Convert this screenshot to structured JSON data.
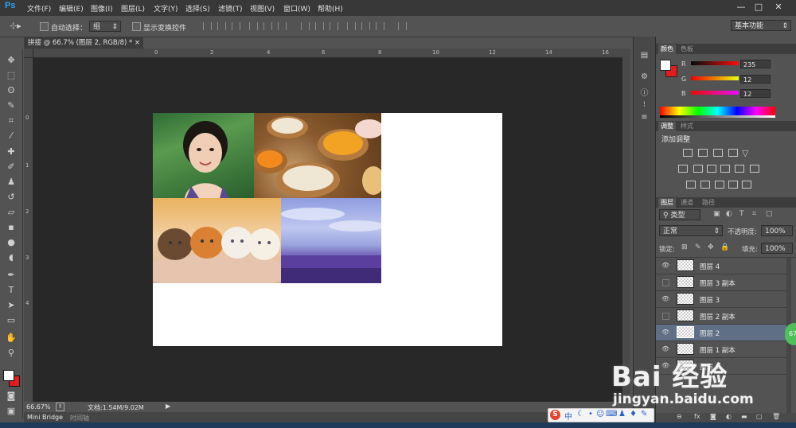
{
  "app": {
    "logo": "Ps"
  },
  "menu": [
    "文件(F)",
    "编辑(E)",
    "图像(I)",
    "图层(L)",
    "文字(Y)",
    "选择(S)",
    "滤镜(T)",
    "视图(V)",
    "窗口(W)",
    "帮助(H)"
  ],
  "window_controls": {
    "minimize": "—",
    "restore": "□",
    "close": "✕"
  },
  "options": {
    "auto_select_label": "自动选择：",
    "auto_select_value": "组",
    "show_transform_label": "显示变换控件",
    "workspace": "基本功能"
  },
  "document": {
    "tab_title": "拼接 @ 66.7% (图层 2, RGB/8) *",
    "close": "×"
  },
  "ruler_top": [
    "0",
    "2",
    "4",
    "6",
    "8",
    "10",
    "12",
    "14",
    "16"
  ],
  "ruler_left": [
    "0",
    "1",
    "2",
    "3",
    "4"
  ],
  "status": {
    "zoom": "66.67%",
    "doc_info": "文档:1.54M/9.02M"
  },
  "bottom_tabs": [
    "Mini Bridge",
    "时间轴"
  ],
  "color_panel": {
    "tabs": [
      "颜色",
      "色板"
    ],
    "r_label": "R",
    "g_label": "G",
    "b_label": "B",
    "r": "235",
    "g": "12",
    "b": "12",
    "foreground": "#eb0c0c"
  },
  "adjust_panel": {
    "tabs": [
      "调整",
      "样式"
    ],
    "title": "添加调整"
  },
  "layers_panel": {
    "tabs": [
      "图层",
      "通道",
      "路径"
    ],
    "filter_type": "类型",
    "blend_mode": "正常",
    "opacity_label": "不透明度:",
    "opacity": "100%",
    "lock_label": "锁定:",
    "fill_label": "填充:",
    "fill": "100%",
    "layers": [
      {
        "name": "图层 4",
        "visible": true,
        "selected": false
      },
      {
        "name": "图层 3 副本",
        "visible": false,
        "selected": false
      },
      {
        "name": "图层 3",
        "visible": true,
        "selected": false
      },
      {
        "name": "图层 2 副本",
        "visible": false,
        "selected": false
      },
      {
        "name": "图层 2",
        "visible": true,
        "selected": true
      },
      {
        "name": "图层 1 副本",
        "visible": true,
        "selected": false
      },
      {
        "name": "图层 1",
        "visible": true,
        "selected": false
      }
    ]
  },
  "overlay": {
    "badge": "67",
    "ime": "中",
    "watermark_brand": "Bai 经验",
    "watermark_url": "jingyan.baidu.com"
  },
  "colors": {
    "accent": "#2fa3f7",
    "selection": "#5e6f86",
    "red": "#e31b1b"
  }
}
